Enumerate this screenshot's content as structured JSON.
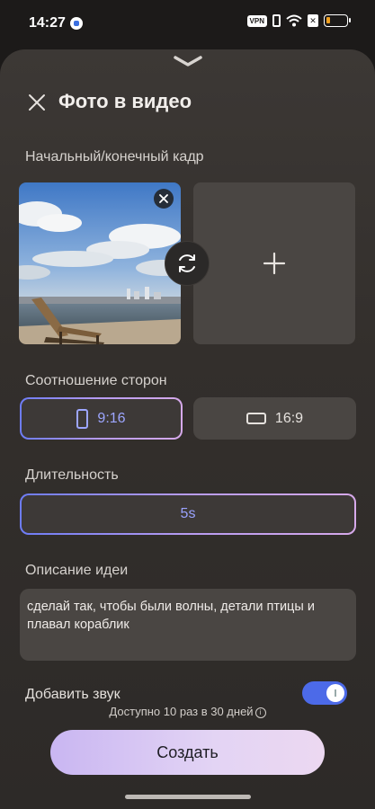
{
  "status_bar": {
    "time": "14:27",
    "vpn_label": "VPN",
    "icons": [
      "app-dot-icon",
      "vpn-icon",
      "vibrate-icon",
      "wifi-icon",
      "sim-x-icon",
      "battery-icon"
    ]
  },
  "sheet": {
    "title": "Фото в видео",
    "close_icon": "close-icon",
    "grab_icon": "chevron-down-icon"
  },
  "frames": {
    "label": "Начальный/конечный кадр",
    "add_symbol": "+",
    "remove_symbol": "×"
  },
  "aspect_ratio": {
    "label": "Соотношение сторон",
    "options": [
      {
        "label": "9:16",
        "selected": true
      },
      {
        "label": "16:9",
        "selected": false
      }
    ]
  },
  "duration": {
    "label": "Длительность",
    "value": "5s"
  },
  "idea": {
    "label": "Описание идеи",
    "text": "сделай так, чтобы были волны, детали птицы и плавал кораблик"
  },
  "sound": {
    "label": "Добавить звук",
    "enabled": true
  },
  "quota": {
    "text": "Доступно 10 раз в 30 дней",
    "info_symbol": "i"
  },
  "create_button": {
    "label": "Создать"
  },
  "colors": {
    "accent": "#4c6ae8",
    "selected_text": "#9da6ff",
    "create_gradient_start": "#c9b6f2",
    "create_gradient_end": "#ecd8f1"
  }
}
